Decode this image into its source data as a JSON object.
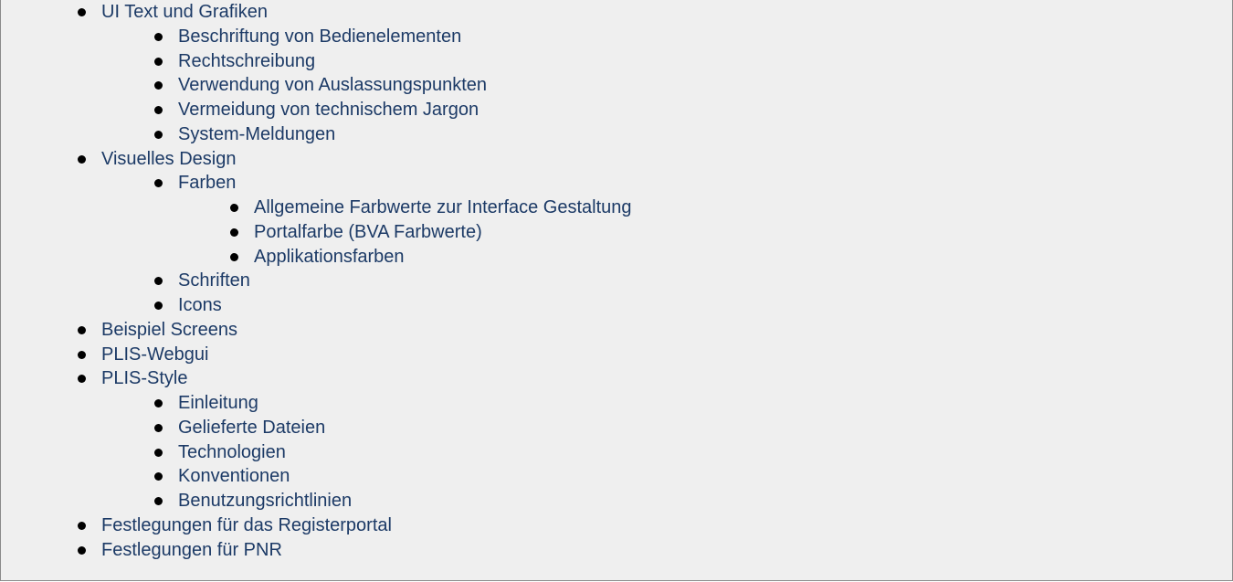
{
  "toc": {
    "items": [
      {
        "label": "UI Text und Grafiken"
      },
      {
        "label": "Beschriftung von Bedienelementen"
      },
      {
        "label": "Rechtschreibung"
      },
      {
        "label": "Verwendung von Auslassungspunkten"
      },
      {
        "label": "Vermeidung von technischem Jargon"
      },
      {
        "label": "System-Meldungen"
      },
      {
        "label": "Visuelles Design"
      },
      {
        "label": "Farben"
      },
      {
        "label": "Allgemeine Farbwerte zur Interface Gestaltung"
      },
      {
        "label": "Portalfarbe (BVA Farbwerte)"
      },
      {
        "label": "Applikationsfarben"
      },
      {
        "label": "Schriften"
      },
      {
        "label": "Icons"
      },
      {
        "label": "Beispiel Screens"
      },
      {
        "label": "PLIS-Webgui"
      },
      {
        "label": "PLIS-Style"
      },
      {
        "label": "Einleitung"
      },
      {
        "label": "Gelieferte Dateien"
      },
      {
        "label": "Technologien"
      },
      {
        "label": "Konventionen"
      },
      {
        "label": "Benutzungsrichtlinien"
      },
      {
        "label": "Festlegungen für das Registerportal"
      },
      {
        "label": "Festlegungen für PNR"
      }
    ]
  },
  "colors": {
    "link": "#1c3a66",
    "background": "#efefef",
    "bullet": "#000000",
    "border": "#8a8a8a"
  }
}
